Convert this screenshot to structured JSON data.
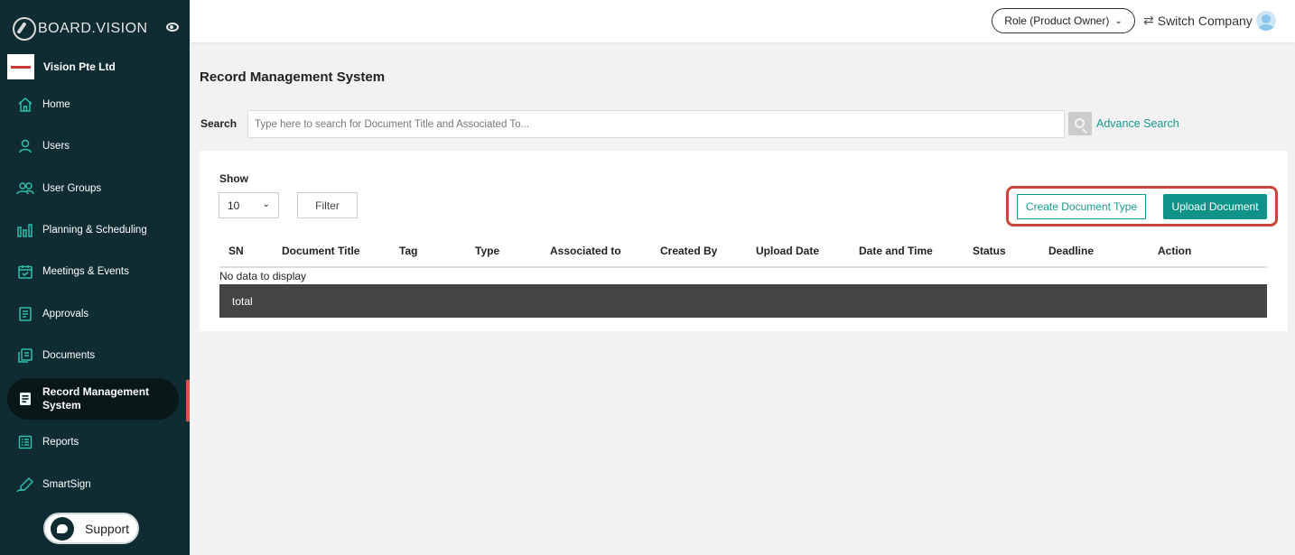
{
  "brand": {
    "name": "BOARD.VISION"
  },
  "company": {
    "name": "Vision Pte Ltd"
  },
  "sidebar": {
    "items": [
      {
        "label": "Home"
      },
      {
        "label": "Users"
      },
      {
        "label": "User Groups"
      },
      {
        "label": "Planning & Scheduling"
      },
      {
        "label": "Meetings & Events"
      },
      {
        "label": "Approvals"
      },
      {
        "label": "Documents"
      },
      {
        "label": "Record Management System"
      },
      {
        "label": "Reports"
      },
      {
        "label": "SmartSign"
      }
    ],
    "active_index": 7,
    "support_label": "Support"
  },
  "header": {
    "role_label": "Role (Product Owner)",
    "switch_label": "Switch Company"
  },
  "main": {
    "title": "Record Management System",
    "search": {
      "label": "Search",
      "placeholder": "Type here to search for Document Title and Associated To...",
      "advance_label": "Advance Search"
    },
    "show_label": "Show",
    "show_value": "10",
    "filter_label": "Filter",
    "create_type_label": "Create Document Type",
    "upload_label": "Upload Document",
    "table": {
      "columns": [
        "SN",
        "Document Title",
        "Tag",
        "Type",
        "Associated to",
        "Created By",
        "Upload Date",
        "Date and Time",
        "Status",
        "Deadline",
        "Action"
      ],
      "empty_text": "No data to display",
      "total_label": "total"
    }
  },
  "colors": {
    "sidebar_bg": "#0f2c33",
    "accent_teal": "#159a8e",
    "highlight_red": "#c9463c"
  }
}
